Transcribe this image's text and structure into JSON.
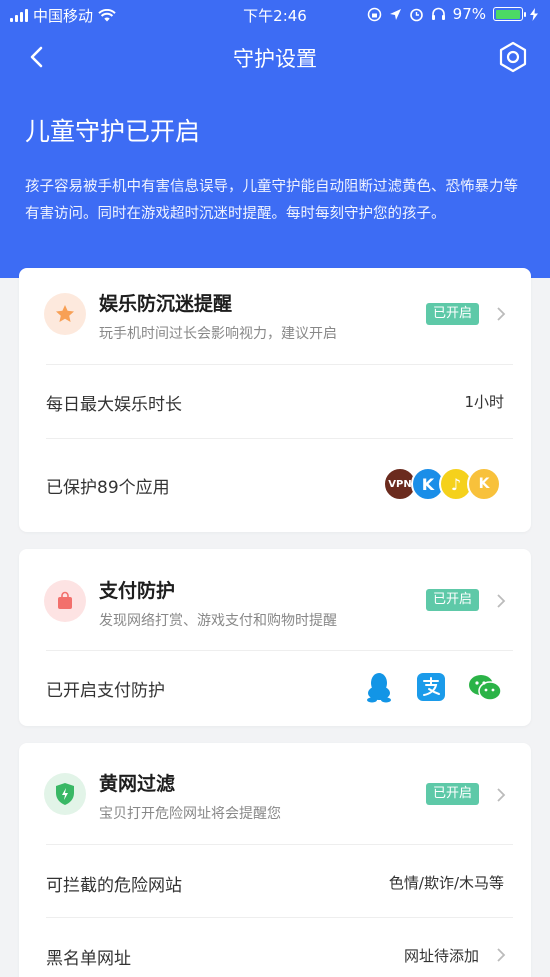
{
  "status": {
    "carrier": "中国移动",
    "time": "下午2:46",
    "battery": "97%",
    "battery_level": 0.97
  },
  "nav": {
    "title": "守护设置"
  },
  "hero": {
    "title": "儿童守护已开启",
    "description": "孩子容易被手机中有害信息误导，儿童守护能自动阻断过滤黄色、恐怖暴力等有害访问。同时在游戏超时沉迷时提醒。每时每刻守护您的孩子。"
  },
  "entertainment": {
    "title": "娱乐防沉迷提醒",
    "subtitle": "玩手机时间过长会影响视力，建议开启",
    "badge": "已开启",
    "max_time_label": "每日最大娱乐时长",
    "max_time_value": "1小时",
    "protected_label": "已保护89个应用",
    "apps": [
      "VPN",
      "K",
      "music",
      "game"
    ]
  },
  "payment": {
    "title": "支付防护",
    "subtitle": "发现网络打赏、游戏支付和购物时提醒",
    "badge": "已开启",
    "status_label": "已开启支付防护",
    "apps": [
      "qq",
      "alipay",
      "wechat"
    ]
  },
  "filter": {
    "title": "黄网过滤",
    "subtitle": "宝贝打开危险网址将会提醒您",
    "badge": "已开启",
    "blockable_label": "可拦截的危险网站",
    "blockable_value": "色情/欺诈/木马等",
    "blacklist_label": "黑名单网址",
    "blacklist_value": "网址待添加"
  },
  "colors": {
    "header": "#3d6cf4",
    "badge": "#5ec9a8",
    "background": "#f2f3f5"
  }
}
